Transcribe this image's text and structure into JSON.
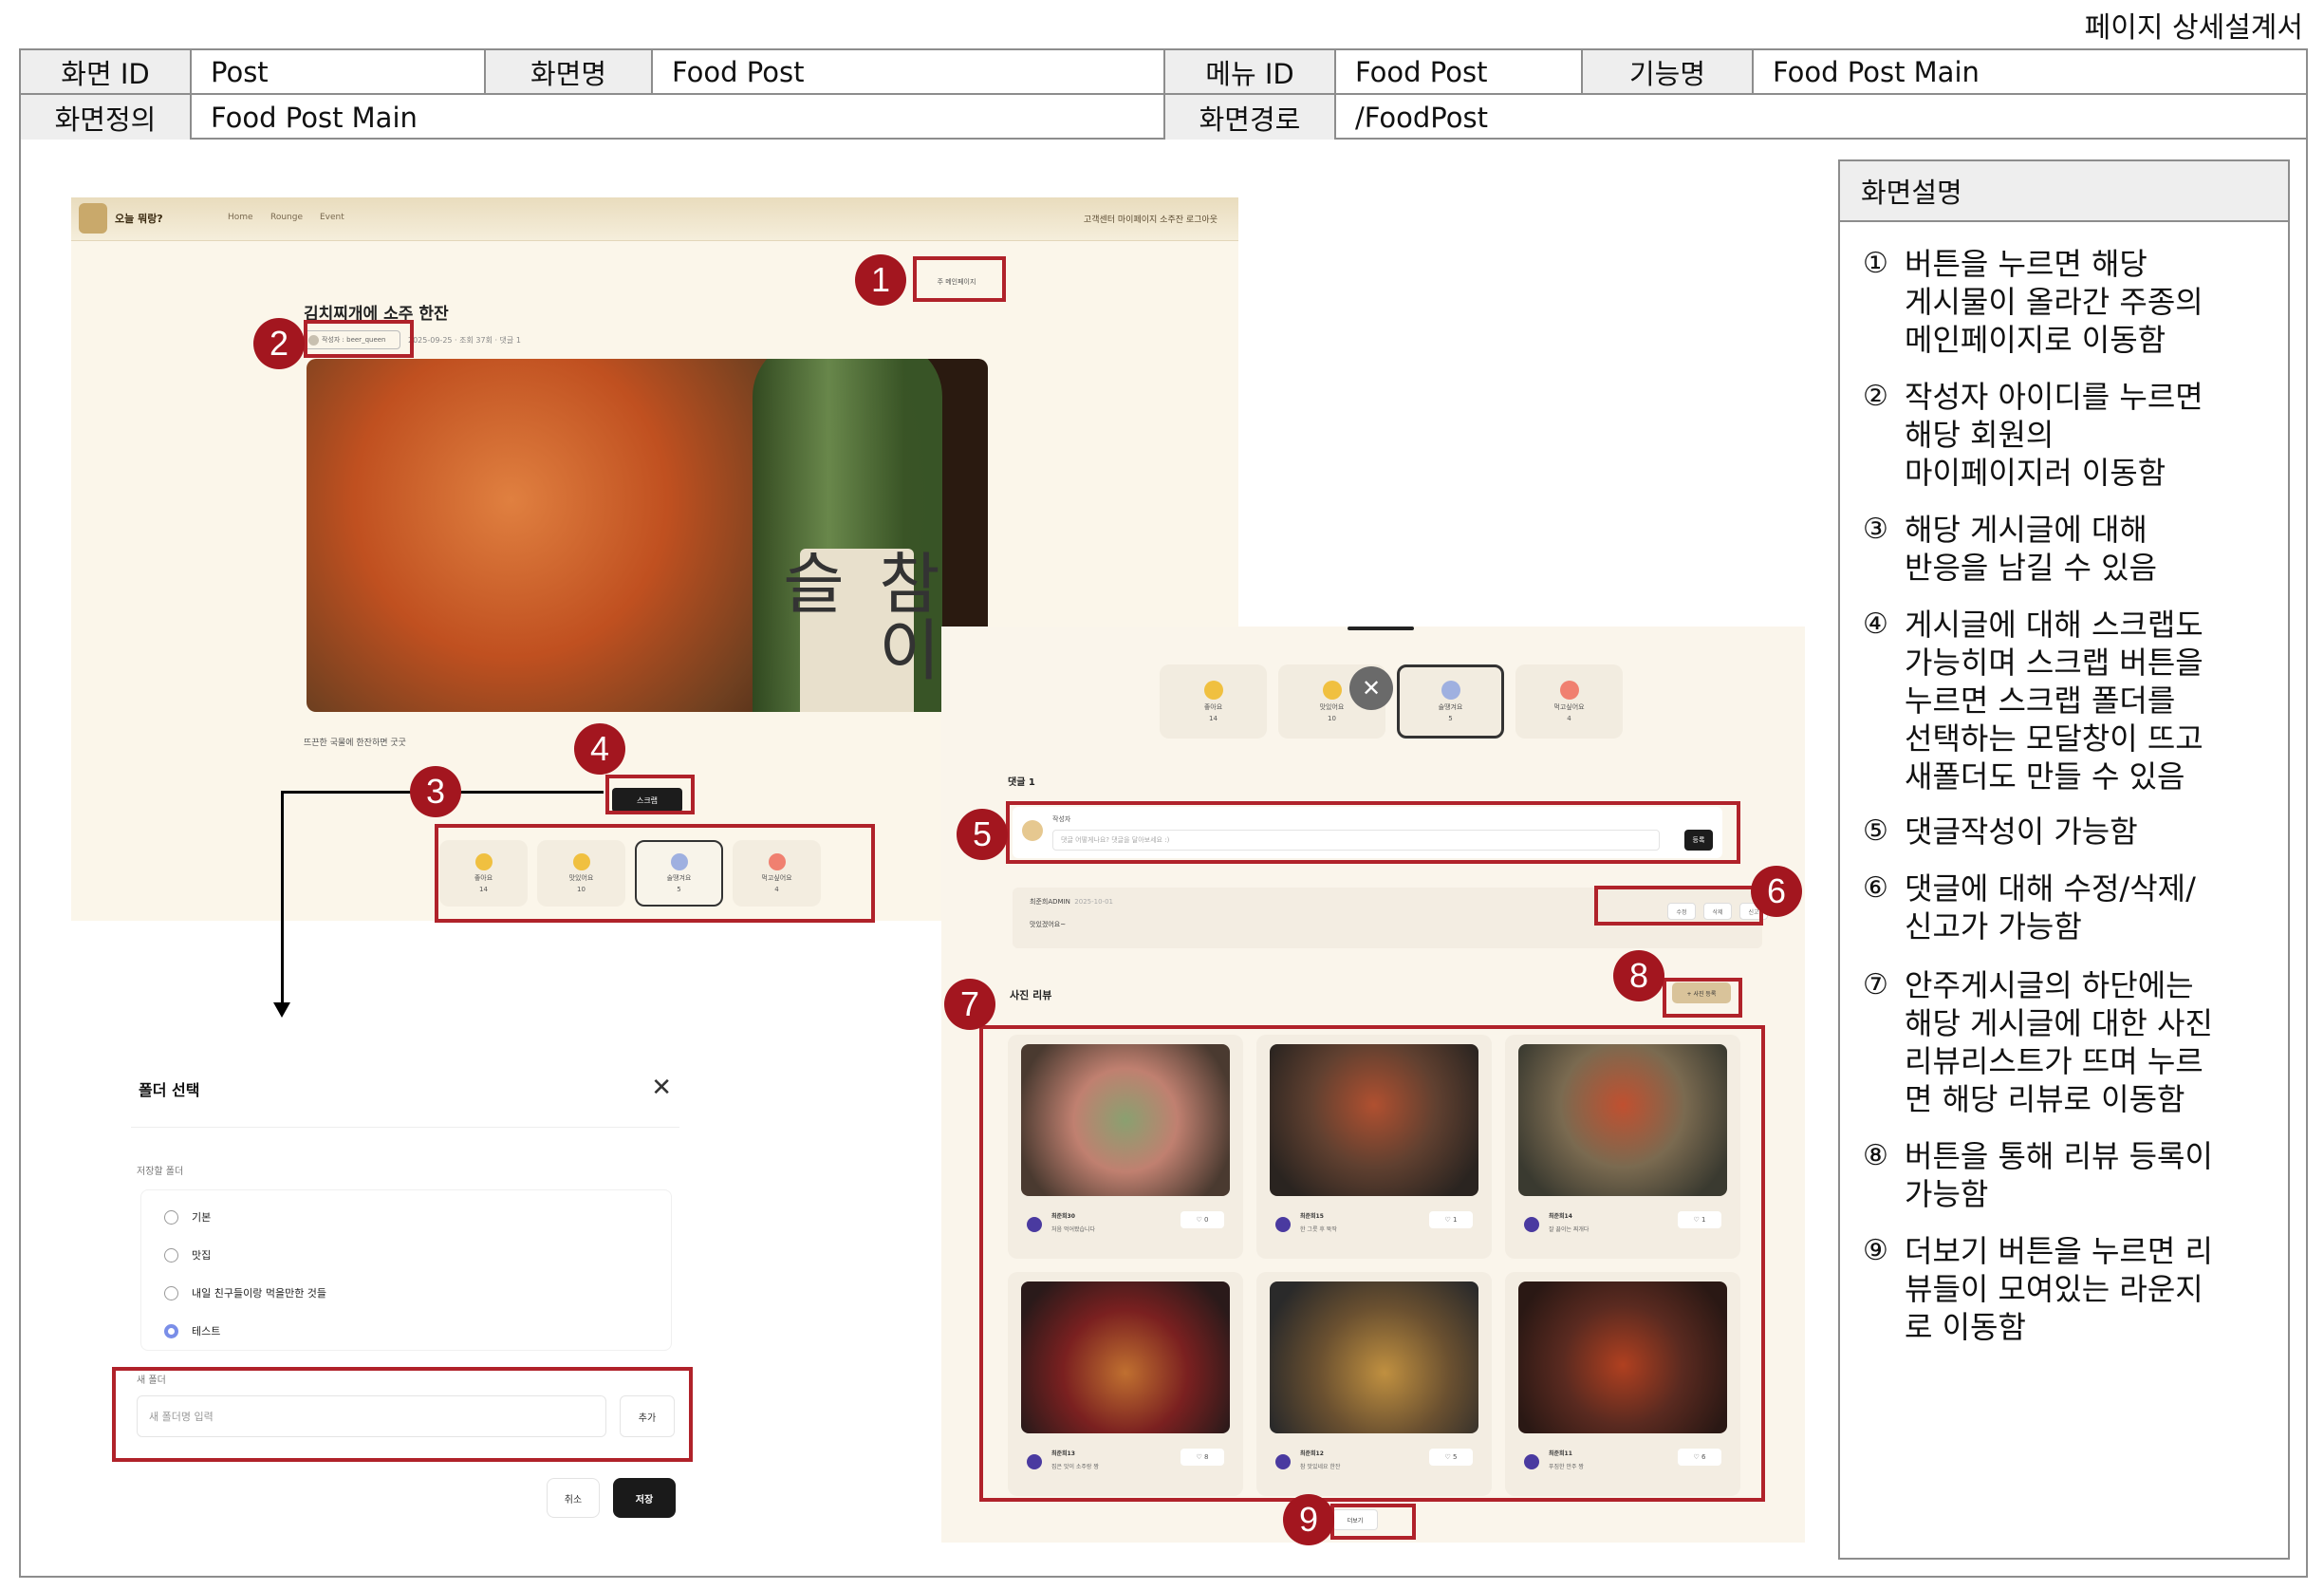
{
  "doc_title": "페이지 상세설계서",
  "header": {
    "screen_id_label": "화면 ID",
    "screen_id": "Post",
    "screen_name_label": "화면명",
    "screen_name": "Food Post",
    "menu_id_label": "메뉴 ID",
    "menu_id": "Food Post",
    "function_label": "기능명",
    "function_name": "Food Post Main",
    "definition_label": "화면정의",
    "definition": "Food Post Main",
    "path_label": "화면경로",
    "path": "/FoodPost"
  },
  "description": {
    "heading": "화면설명",
    "items": [
      {
        "num": "①",
        "text": "버튼을 누르면 해당\n게시물이 올라간 주종의\n메인페이지로 이동함"
      },
      {
        "num": "②",
        "text": "작성자 아이디를 누르면\n해당 회원의\n마이페이지러 이동함"
      },
      {
        "num": "③",
        "text": "해당 게시글에 대해\n반응을 남길 수 있음"
      },
      {
        "num": "④",
        "text": "게시글에 대해 스크랩도\n가능히며 스크랩 버튼을\n누르면 스크랩 폴더를\n선택하는 모달창이 뜨고\n새폴더도 만들 수 있음"
      },
      {
        "num": "⑤",
        "text": "댓글작성이 가능함"
      },
      {
        "num": "⑥",
        "text": "댓글에 대해 수정/삭제/\n신고가 가능함"
      },
      {
        "num": "⑦",
        "text": "안주게시글의 하단에는\n해당 게시글에 대한 사진\n리뷰리스트가 뜨며 누르\n면 해당 리뷰로 이동함"
      },
      {
        "num": "⑧",
        "text": "버튼을 통해 리뷰 등록이\n가능함"
      },
      {
        "num": "⑨",
        "text": "더보기 버튼을 누르면 리\n뷰들이 모여있는 라운지\n로 이동함"
      }
    ]
  },
  "shot1": {
    "site_name": "오늘 뭐랑?",
    "nav": [
      "Home",
      "Rounge",
      "Event"
    ],
    "nav_right": "고객센터 마이페이지 소주잔 로그아웃",
    "main_page_btn": "주 메인페이지",
    "post_title": "김치찌개에 소주 한잔",
    "author": "작성자 : beer_queen",
    "meta": "2025-09-25 · 조회 37회 · 댓글 1",
    "bottle_text": "참이슬",
    "caption": "뜨끈한 국물에 한잔하면 굿굿",
    "scrap_label": "스크랩",
    "reactions": [
      {
        "label": "좋아요",
        "count": "14"
      },
      {
        "label": "맛있어요",
        "count": "10"
      },
      {
        "label": "술땡겨요",
        "count": "5"
      },
      {
        "label": "먹고싶어요",
        "count": "4"
      }
    ]
  },
  "shot2": {
    "comment_count": "댓글 1",
    "comment_user": "작성자",
    "comment_placeholder": "댓글 어떻게나요? 댓글을 달아보세요 :)",
    "comment_submit": "등록",
    "comment": {
      "user": "최준희ADMIN",
      "date": "2025-10-01",
      "text": "맛있겠어요~"
    },
    "comment_actions": [
      "수정",
      "삭제",
      "신고"
    ],
    "review_title": "사진 리뷰",
    "add_review": "+ 사진 등록",
    "reviews": [
      {
        "name": "최준희30",
        "sub": "처음 먹어봤습니다",
        "likes": "0"
      },
      {
        "name": "최준희15",
        "sub": "한 그릇 후 뚝딱",
        "likes": "1"
      },
      {
        "name": "최준희14",
        "sub": "잘 끓이는 찌개다",
        "likes": "1"
      },
      {
        "name": "최준희13",
        "sub": "집은 맛이 소주랑 짱",
        "likes": "8"
      },
      {
        "name": "최준희12",
        "sub": "참 맛있네요 한잔",
        "likes": "5"
      },
      {
        "name": "최준희11",
        "sub": "푸짐한 안주 짱",
        "likes": "6"
      }
    ],
    "more_btn": "더보기"
  },
  "modal": {
    "title": "폴더 선택",
    "save_folder_label": "저장할 폴더",
    "folders": [
      "기본",
      "맛집",
      "내일 친구들이랑 먹을만한 것들",
      "테스트"
    ],
    "selected": "테스트",
    "new_folder_label": "새 폴더",
    "new_folder_placeholder": "새 폴더명 입력",
    "add_btn": "추가",
    "cancel_btn": "취소",
    "save_btn": "저장"
  },
  "annotations": [
    "1",
    "2",
    "3",
    "4",
    "5",
    "6",
    "7",
    "8",
    "9"
  ],
  "colors": {
    "annotation": "#b0222a",
    "badge": "#a3161f",
    "beige": "#fbf6ea"
  }
}
